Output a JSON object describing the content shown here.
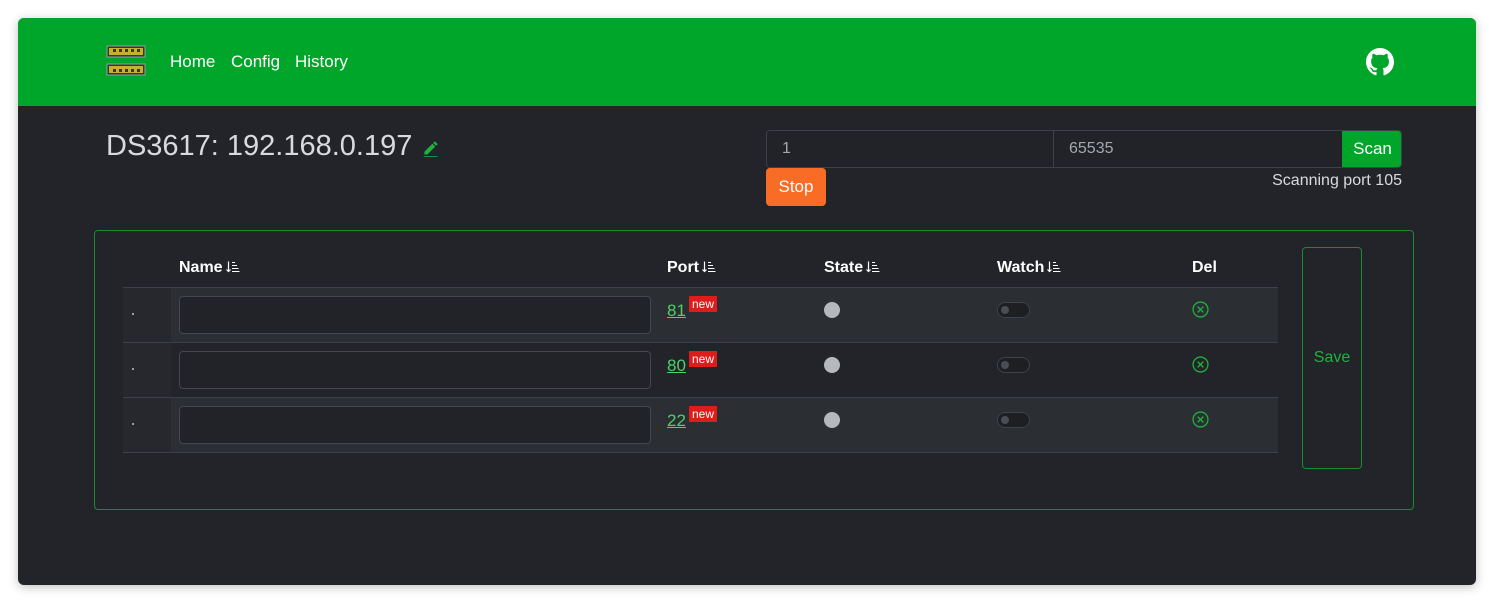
{
  "colors": {
    "brand": "#00a62a",
    "background": "#222429",
    "stop": "#f96c25",
    "badge": "#e01b1b",
    "port_link": "#4dd168"
  },
  "nav": {
    "logo_icon": "ethernet-ports-icon",
    "links": [
      "Home",
      "Config",
      "History"
    ],
    "github_icon": "github-icon"
  },
  "host": {
    "title": "DS3617: 192.168.0.197",
    "edit_icon": "pencil-icon"
  },
  "scan": {
    "start_port": "1",
    "end_port": "65535",
    "scan_label": "Scan",
    "stop_label": "Stop",
    "status": "Scanning port 105"
  },
  "table": {
    "headers": {
      "name": "Name",
      "port": "Port",
      "state": "State",
      "watch": "Watch",
      "del": "Del"
    },
    "sort_icon": "sort-descending-icon",
    "rows": [
      {
        "name": "",
        "port": "81",
        "badge": "new",
        "state": "unknown",
        "watch": false
      },
      {
        "name": "",
        "port": "80",
        "badge": "new",
        "state": "unknown",
        "watch": false
      },
      {
        "name": "",
        "port": "22",
        "badge": "new",
        "state": "unknown",
        "watch": false
      }
    ],
    "save_label": "Save"
  }
}
